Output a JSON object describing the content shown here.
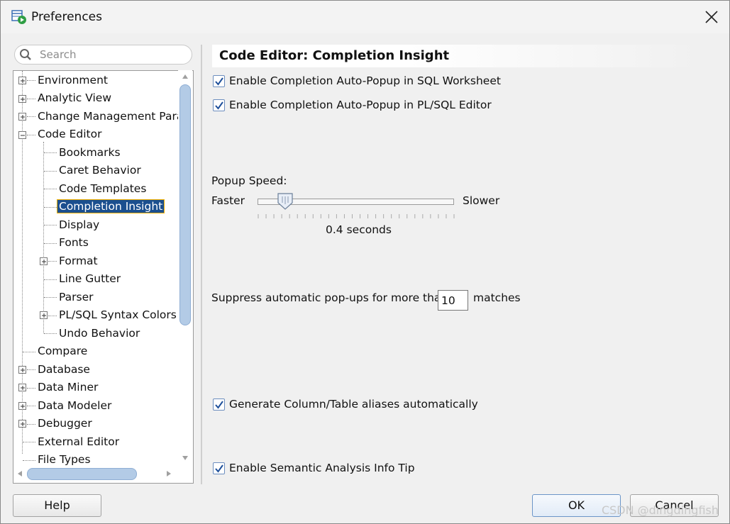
{
  "window": {
    "title": "Preferences"
  },
  "search": {
    "placeholder": "Search"
  },
  "tree": {
    "items": [
      {
        "label": "Environment"
      },
      {
        "label": "Analytic View"
      },
      {
        "label": "Change Management Parar"
      },
      {
        "label": "Code Editor"
      },
      {
        "label": "Bookmarks"
      },
      {
        "label": "Caret Behavior"
      },
      {
        "label": "Code Templates"
      },
      {
        "label": "Completion Insight"
      },
      {
        "label": "Display"
      },
      {
        "label": "Fonts"
      },
      {
        "label": "Format"
      },
      {
        "label": "Line Gutter"
      },
      {
        "label": "Parser"
      },
      {
        "label": "PL/SQL Syntax Colors"
      },
      {
        "label": "Undo Behavior"
      },
      {
        "label": "Compare"
      },
      {
        "label": "Database"
      },
      {
        "label": "Data Miner"
      },
      {
        "label": "Data Modeler"
      },
      {
        "label": "Debugger"
      },
      {
        "label": "External Editor"
      },
      {
        "label": "File Types"
      }
    ],
    "selected": "Completion Insight"
  },
  "panel": {
    "title": "Code Editor: Completion Insight",
    "checkboxes": [
      {
        "label": "Enable Completion Auto-Popup in SQL Worksheet",
        "checked": true
      },
      {
        "label": "Enable Completion Auto-Popup in PL/SQL Editor",
        "checked": true
      },
      {
        "label": "Generate Column/Table aliases automatically",
        "checked": true
      },
      {
        "label": "Enable Semantic Analysis Info Tip",
        "checked": true
      }
    ],
    "popup_speed": {
      "label": "Popup Speed:",
      "min_label": "Faster",
      "max_label": "Slower",
      "value_text": "0.4 seconds",
      "fraction": 0.1
    },
    "suppress": {
      "prefix": "Suppress automatic pop-ups for more than",
      "value": "10",
      "suffix": "matches"
    }
  },
  "buttons": {
    "help": "Help",
    "ok": "OK",
    "cancel": "Cancel"
  },
  "watermark": "CSDN @dingdingfish",
  "colors": {
    "selection": "#1b4f8f",
    "selection_outline": "#f0b000",
    "scroll_thumb": "#b3cbe6"
  }
}
